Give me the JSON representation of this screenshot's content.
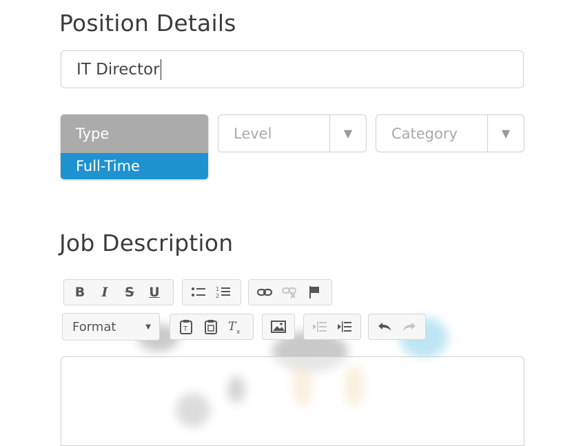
{
  "position_details": {
    "heading": "Position Details",
    "title_value": "IT Director"
  },
  "type_dropdown": {
    "header": "Type",
    "selected": "Full-Time",
    "selected_color": "#1f92d0"
  },
  "level_select": {
    "placeholder": "Level"
  },
  "category_select": {
    "placeholder": "Category"
  },
  "job_description": {
    "heading": "Job Description",
    "toolbar": {
      "bold": "B",
      "italic": "I",
      "strike": "S",
      "underline": "U",
      "format": "Format"
    }
  },
  "icons": {
    "bulleted_list": "bulleted-list-icon",
    "numbered_list": "numbered-list-icon",
    "link": "link-icon",
    "unlink": "unlink-icon",
    "anchor": "flag-icon",
    "paste_text": "paste-text-icon",
    "paste_word": "paste-word-icon",
    "remove_format": "remove-format-icon",
    "image": "image-icon",
    "outdent": "outdent-icon",
    "indent": "indent-icon",
    "undo": "undo-icon",
    "redo": "redo-icon"
  }
}
